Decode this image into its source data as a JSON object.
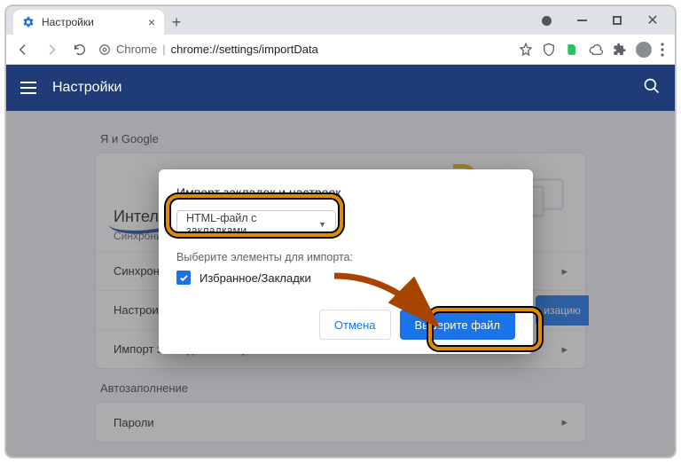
{
  "browser": {
    "tab_title": "Настройки",
    "url_chip": "Chrome",
    "url_path": "chrome://settings/importData"
  },
  "header": {
    "title": "Настройки"
  },
  "page": {
    "section_account": "Я и Google",
    "intro_title": "Интелл",
    "intro_sub": "Синхрониз",
    "sync_btn_peek": "изацию",
    "row_sync": "Синхрониз",
    "row_customize": "Настроить",
    "row_import": "Импорт закладок и настроек",
    "section_autofill": "Автозаполнение",
    "row_passwords": "Пароли"
  },
  "dialog": {
    "title": "Импорт закладок и настроек",
    "select_value": "HTML-файл с закладками",
    "subtitle": "Выберите элементы для импорта:",
    "checkbox_label": "Избранное/Закладки",
    "cancel": "Отмена",
    "choose_file": "Выберите файл"
  }
}
